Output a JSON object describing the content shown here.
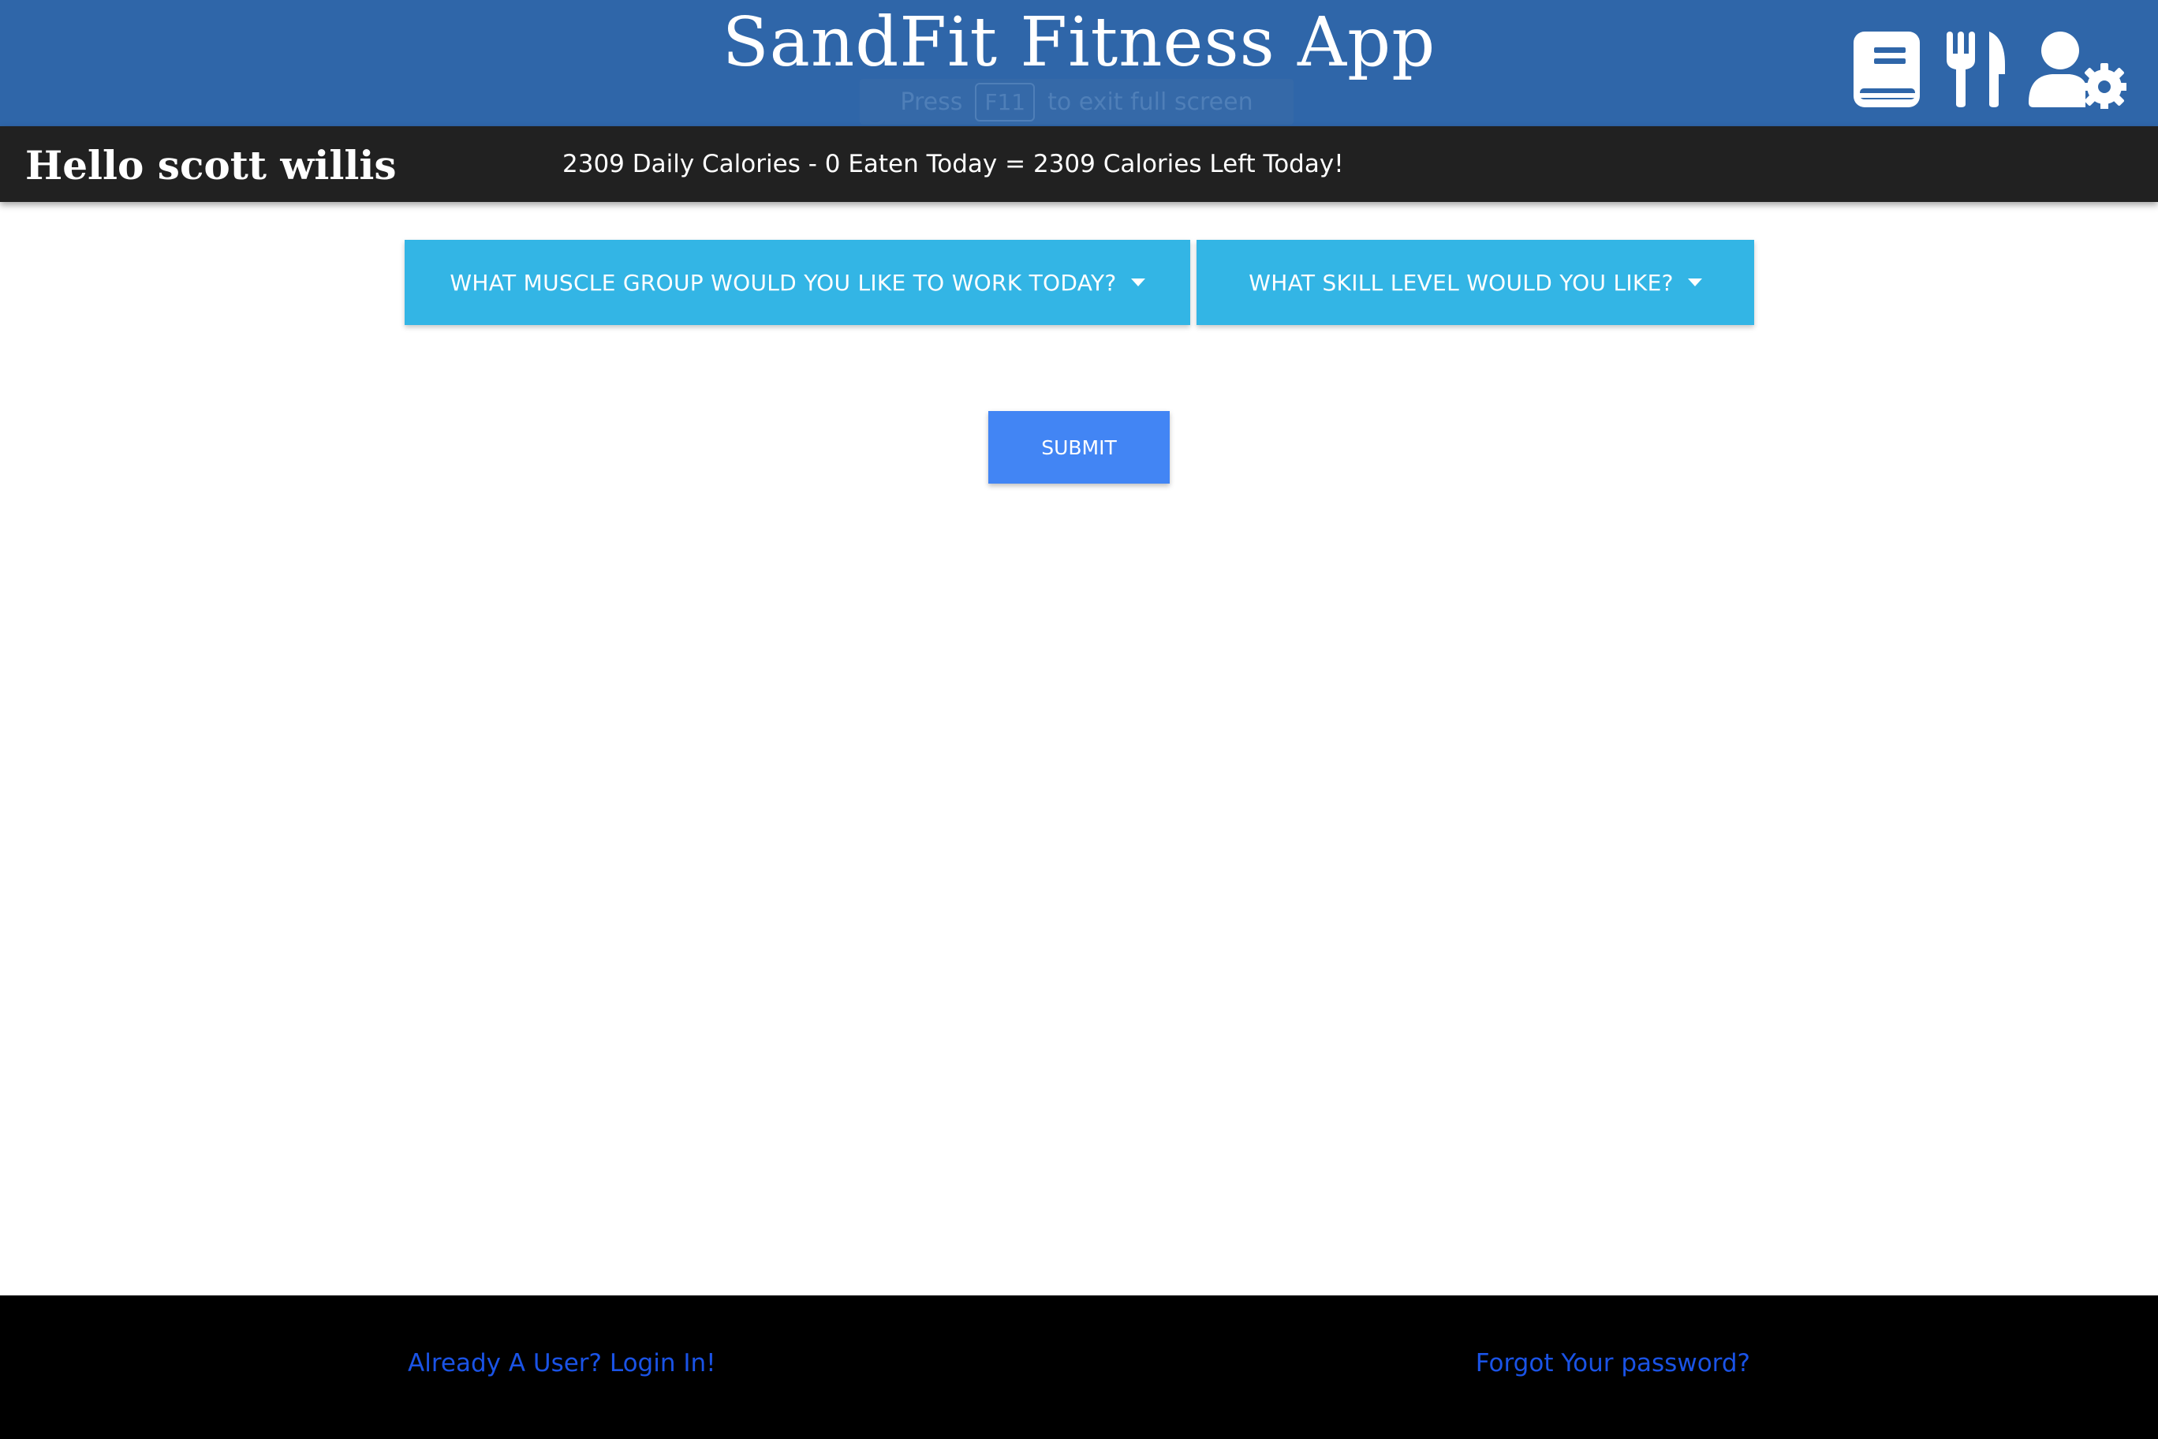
{
  "header": {
    "title": "SandFit Fitness App",
    "fullscreen_notice": {
      "press": "Press",
      "key": "F11",
      "suffix": "to exit full screen"
    },
    "icons": [
      "journal-icon",
      "utensils-icon",
      "user-settings-icon"
    ],
    "background": "#2f66a9"
  },
  "greeting_bar": {
    "greeting": "Hello scott willis",
    "calories_text": "2309 Daily Calories - 0 Eaten Today = 2309 Calories Left Today!",
    "background": "#212121"
  },
  "main": {
    "muscle_dropdown_label": "WHAT MUSCLE GROUP WOULD YOU LIKE TO WORK TODAY?",
    "skill_dropdown_label": "WHAT SKILL LEVEL WOULD YOU LIKE?",
    "submit_label": "SUBMIT",
    "dropdown_color": "#33b5e5",
    "submit_color": "#4285f4"
  },
  "footer": {
    "login_link": "Already A User? Login In!",
    "forgot_link": "Forgot Your password?",
    "link_color": "#1a53e6"
  }
}
